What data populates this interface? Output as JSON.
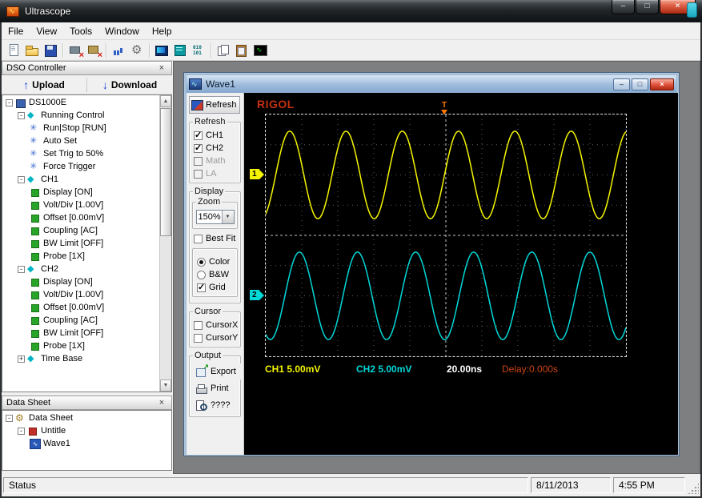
{
  "window": {
    "title": "Ultrascope"
  },
  "menu_bar": {
    "items": [
      "File",
      "View",
      "Tools",
      "Window",
      "Help"
    ]
  },
  "toolbar": {
    "items": [
      {
        "name": "new-document",
        "icon": "new"
      },
      {
        "name": "open-file",
        "icon": "open"
      },
      {
        "name": "save",
        "icon": "save"
      },
      {
        "sep": true
      },
      {
        "name": "connect-device",
        "icon": "connx"
      },
      {
        "name": "disconnect-device",
        "icon": "discx"
      },
      {
        "sep": true
      },
      {
        "name": "counter",
        "icon": "bars"
      },
      {
        "name": "options-gear",
        "icon": "gear"
      },
      {
        "sep": true
      },
      {
        "name": "virtual-panel",
        "icon": "panel"
      },
      {
        "name": "measure-display",
        "icon": "meter"
      },
      {
        "name": "binary-data",
        "icon": "binary"
      },
      {
        "sep": true
      },
      {
        "name": "copy",
        "icon": "copy"
      },
      {
        "name": "paste",
        "icon": "paste"
      },
      {
        "name": "waveform-view",
        "icon": "wavef"
      }
    ]
  },
  "dso_controller": {
    "title": "DSO Controller",
    "upload_label": "Upload",
    "download_label": "Download",
    "tree": [
      {
        "label": "DS1000E",
        "depth": 0,
        "icon": "device",
        "expanded": true
      },
      {
        "label": "Running Control",
        "depth": 1,
        "icon": "diamond",
        "expanded": true
      },
      {
        "label": "Run|Stop [RUN]",
        "depth": 2,
        "icon": "snowflake"
      },
      {
        "label": "Auto Set",
        "depth": 2,
        "icon": "snowflake"
      },
      {
        "label": "Set Trig to 50%",
        "depth": 2,
        "icon": "snowflake"
      },
      {
        "label": "Force Trigger",
        "depth": 2,
        "icon": "snowflake"
      },
      {
        "label": "CH1",
        "depth": 1,
        "icon": "diamond",
        "expanded": true
      },
      {
        "label": "Display [ON]",
        "depth": 2,
        "icon": "green-square"
      },
      {
        "label": "Volt/Div [1.00V]",
        "depth": 2,
        "icon": "green-square"
      },
      {
        "label": "Offset [0.00mV]",
        "depth": 2,
        "icon": "green-square"
      },
      {
        "label": "Coupling [AC]",
        "depth": 2,
        "icon": "green-square"
      },
      {
        "label": "BW Limit [OFF]",
        "depth": 2,
        "icon": "green-square"
      },
      {
        "label": "Probe [1X]",
        "depth": 2,
        "icon": "green-square"
      },
      {
        "label": "CH2",
        "depth": 1,
        "icon": "diamond",
        "expanded": true
      },
      {
        "label": "Display [ON]",
        "depth": 2,
        "icon": "green-square"
      },
      {
        "label": "Volt/Div [1.00V]",
        "depth": 2,
        "icon": "green-square"
      },
      {
        "label": "Offset [0.00mV]",
        "depth": 2,
        "icon": "green-square"
      },
      {
        "label": "Coupling [AC]",
        "depth": 2,
        "icon": "green-square"
      },
      {
        "label": "BW Limit [OFF]",
        "depth": 2,
        "icon": "green-square"
      },
      {
        "label": "Probe [1X]",
        "depth": 2,
        "icon": "green-square"
      },
      {
        "label": "Time Base",
        "depth": 1,
        "icon": "diamond",
        "expanded": false
      }
    ]
  },
  "data_sheet": {
    "title": "Data Sheet",
    "tree": [
      {
        "label": "Data Sheet",
        "depth": 0,
        "icon": "gear",
        "expanded": true
      },
      {
        "label": "Untitle",
        "depth": 1,
        "icon": "red-box",
        "expanded": true
      },
      {
        "label": "Wave1",
        "depth": 2,
        "icon": "wave"
      }
    ]
  },
  "wave_window": {
    "title": "Wave1",
    "refresh_button_label": "Refresh",
    "refresh_group": {
      "label": "Refresh",
      "items": [
        {
          "label": "CH1",
          "checked": true
        },
        {
          "label": "CH2",
          "checked": true
        },
        {
          "label": "Math",
          "checked": false,
          "disabled": true
        },
        {
          "label": "LA",
          "checked": false,
          "disabled": true
        }
      ]
    },
    "display_group": {
      "label": "Display",
      "zoom_label": "Zoom",
      "zoom_value": "150%",
      "best_fit_label": "Best Fit",
      "best_fit_checked": false,
      "color_label": "Color",
      "bw_label": "B&W",
      "color_selected": "color",
      "grid_label": "Grid",
      "grid_checked": true
    },
    "cursor_group": {
      "label": "Cursor",
      "items": [
        {
          "label": "CursorX",
          "checked": false
        },
        {
          "label": "CursorY",
          "checked": false
        }
      ]
    },
    "output_group": {
      "label": "Output",
      "buttons": [
        {
          "label": "Export",
          "icon": "export"
        },
        {
          "label": "Print",
          "icon": "print"
        },
        {
          "label": "????",
          "icon": "preview"
        }
      ]
    },
    "scope": {
      "brand": "RIGOL",
      "ch1_label": "CH1 5.00mV",
      "ch2_label": "CH2 5.00mV",
      "timebase_label": "20.00ns",
      "delay_label": "Delay:0.000s"
    }
  },
  "status_bar": {
    "status": "Status",
    "date": "8/11/2013",
    "time": "4:55 PM"
  },
  "chart_data": {
    "type": "line",
    "title": "Wave1 oscilloscope capture",
    "grid": {
      "x_divisions": 10,
      "y_divisions": 8,
      "time_per_div": "20.00ns"
    },
    "trigger": {
      "position_div": 0,
      "delay": "0.000s"
    },
    "series": [
      {
        "name": "CH1",
        "color": "#f5f500",
        "volts_per_div": "5.00mV",
        "cycles": 6.4,
        "amplitude_div": 1.45,
        "center_div": -2,
        "phase": -1.11
      },
      {
        "name": "CH2",
        "color": "#00d8d8",
        "volts_per_div": "5.00mV",
        "cycles": 6.2,
        "amplitude_div": 1.45,
        "center_div": 2,
        "phase": -2.07
      }
    ]
  }
}
